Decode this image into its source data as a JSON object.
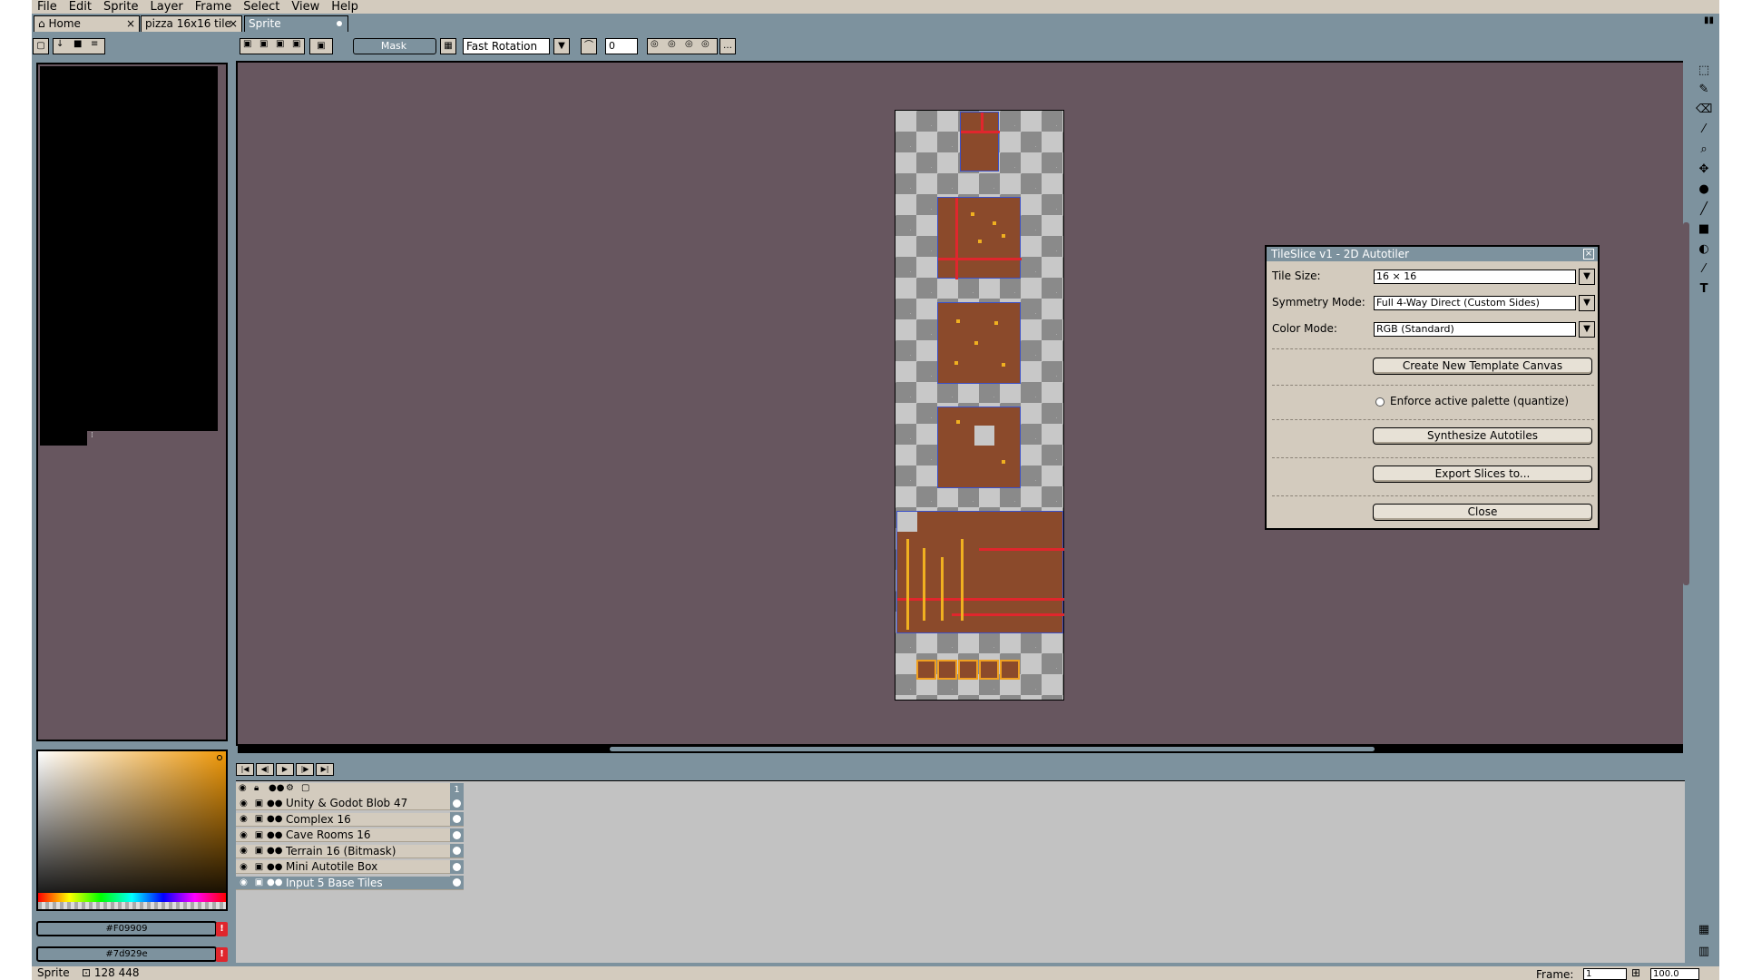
{
  "menu": [
    "File",
    "Edit",
    "Sprite",
    "Layer",
    "Frame",
    "Select",
    "View",
    "Help"
  ],
  "tabs": [
    {
      "label": "Home"
    },
    {
      "label": "pizza 16x16 tile"
    },
    {
      "label": "Sprite"
    }
  ],
  "toolbar": {
    "mask_label": "Mask",
    "rotation_mode": "Fast Rotation",
    "angle_value": "0"
  },
  "colors": {
    "foreground": "#F09909",
    "background": "#7d929e",
    "warn_glyph": "!"
  },
  "dialog": {
    "title": "TileSlice v1 - 2D Autotiler",
    "close_glyph": "×",
    "tile_size_label": "Tile Size:",
    "tile_size_value": "16 × 16",
    "symmetry_label": "Symmetry Mode:",
    "symmetry_value": "Full 4-Way Direct (Custom Sides)",
    "color_mode_label": "Color Mode:",
    "color_mode_value": "RGB (Standard)",
    "create_button": "Create New Template Canvas",
    "enforce_label": "Enforce active palette (quantize)",
    "synthesize_button": "Synthesize Autotiles",
    "export_button": "Export Slices to...",
    "close_button": "Close"
  },
  "layers": [
    {
      "name": "Unity & Godot Blob 47",
      "selected": false
    },
    {
      "name": "Complex 16",
      "selected": false
    },
    {
      "name": "Cave Rooms 16",
      "selected": false
    },
    {
      "name": "Terrain 16 (Bitmask)",
      "selected": false
    },
    {
      "name": "Mini Autotile Box",
      "selected": false
    },
    {
      "name": "Input 5 Base Tiles",
      "selected": true
    }
  ],
  "timeline": {
    "frame_header": "1"
  },
  "status": {
    "label": "Sprite",
    "size": "128 448",
    "frame_label": "Frame:",
    "frame_value": "1",
    "zoom_value": "100.0"
  }
}
